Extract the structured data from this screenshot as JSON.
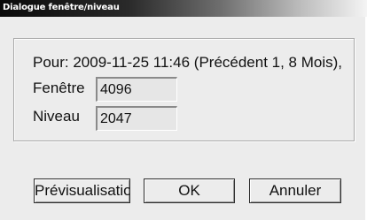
{
  "window": {
    "title": "Dialogue fenêtre/niveau"
  },
  "summary": {
    "text": "Pour: 2009-11-25 11:46 (Précédent 1, 8 Mois),"
  },
  "fields": {
    "window_label": "Fenêtre",
    "window_value": "4096",
    "level_label": "Niveau",
    "level_value": "2047"
  },
  "buttons": {
    "preview_label": "Prévisualisation",
    "ok_label": "OK",
    "cancel_label": "Annuler"
  }
}
